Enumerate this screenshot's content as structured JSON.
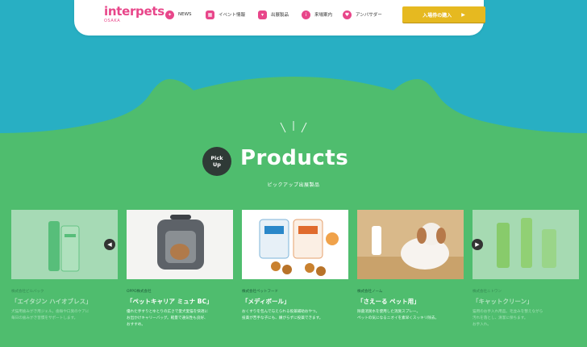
{
  "nav": {
    "brand": "interpets",
    "city": "OSAKA",
    "items": [
      {
        "label": "NEWS",
        "icon": "megaphone-icon"
      },
      {
        "label": "イベント情報",
        "icon": "calendar-icon"
      },
      {
        "label": "出展製品",
        "icon": "cat-face-icon"
      },
      {
        "label": "来場案内",
        "icon": "info-icon"
      },
      {
        "label": "アンバサダー",
        "icon": "shield-icon"
      }
    ],
    "buy_label": "入場券の購入",
    "buy_arrow": "▶"
  },
  "section": {
    "badge_line1": "Pick",
    "badge_line2": "Up",
    "title": "Products",
    "subtitle": "ピックアップ出展製品"
  },
  "carousel": {
    "prev": "◀",
    "next": "▶",
    "cards": [
      {
        "meta": "株式会社ビルバック",
        "name": "「エイタジン ハイオブレス」",
        "desc1": "犬猫用歯みがき用ジェル。歯垢や口臭のケアに",
        "desc2": "毎日の歯みがき習慣をサポートします。"
      },
      {
        "meta": "OPPO株式会社",
        "name": "「ペットキャリア ミュナ BC」",
        "desc1": "優れた手すりとゆとりの広さで愛犬愛猫を快適に",
        "desc2": "お出かけキャリーバッグ。軽量で通気性も良好、",
        "desc3": "おすすめ。"
      },
      {
        "meta": "株式会社ペットフード",
        "name": "「メディボール」",
        "desc1": "おくすりを包んで与えられる投薬補助おやつ。",
        "desc2": "投薬が苦手な子にも、嫌がらずに投薬できます。"
      },
      {
        "meta": "株式会社ノーム",
        "name": "「さえーる ペット用」",
        "desc1": "除菌消臭水を使用した消臭スプレー。",
        "desc2": "ペットの気になるニオイを素早くスッキリ除去。"
      },
      {
        "meta": "株式会社ニトワン",
        "name": "「キャットクリーン」",
        "desc1": "猫用のお手入れ用品。毛並みを整えながら",
        "desc2": "汚れを落とし、清潔に保ちます。",
        "desc3": "お手入れ。"
      }
    ]
  },
  "colors": {
    "sky": "#28afc3",
    "grass": "#4fbd6e",
    "accent": "#e8468a",
    "button": "#e6b920"
  }
}
